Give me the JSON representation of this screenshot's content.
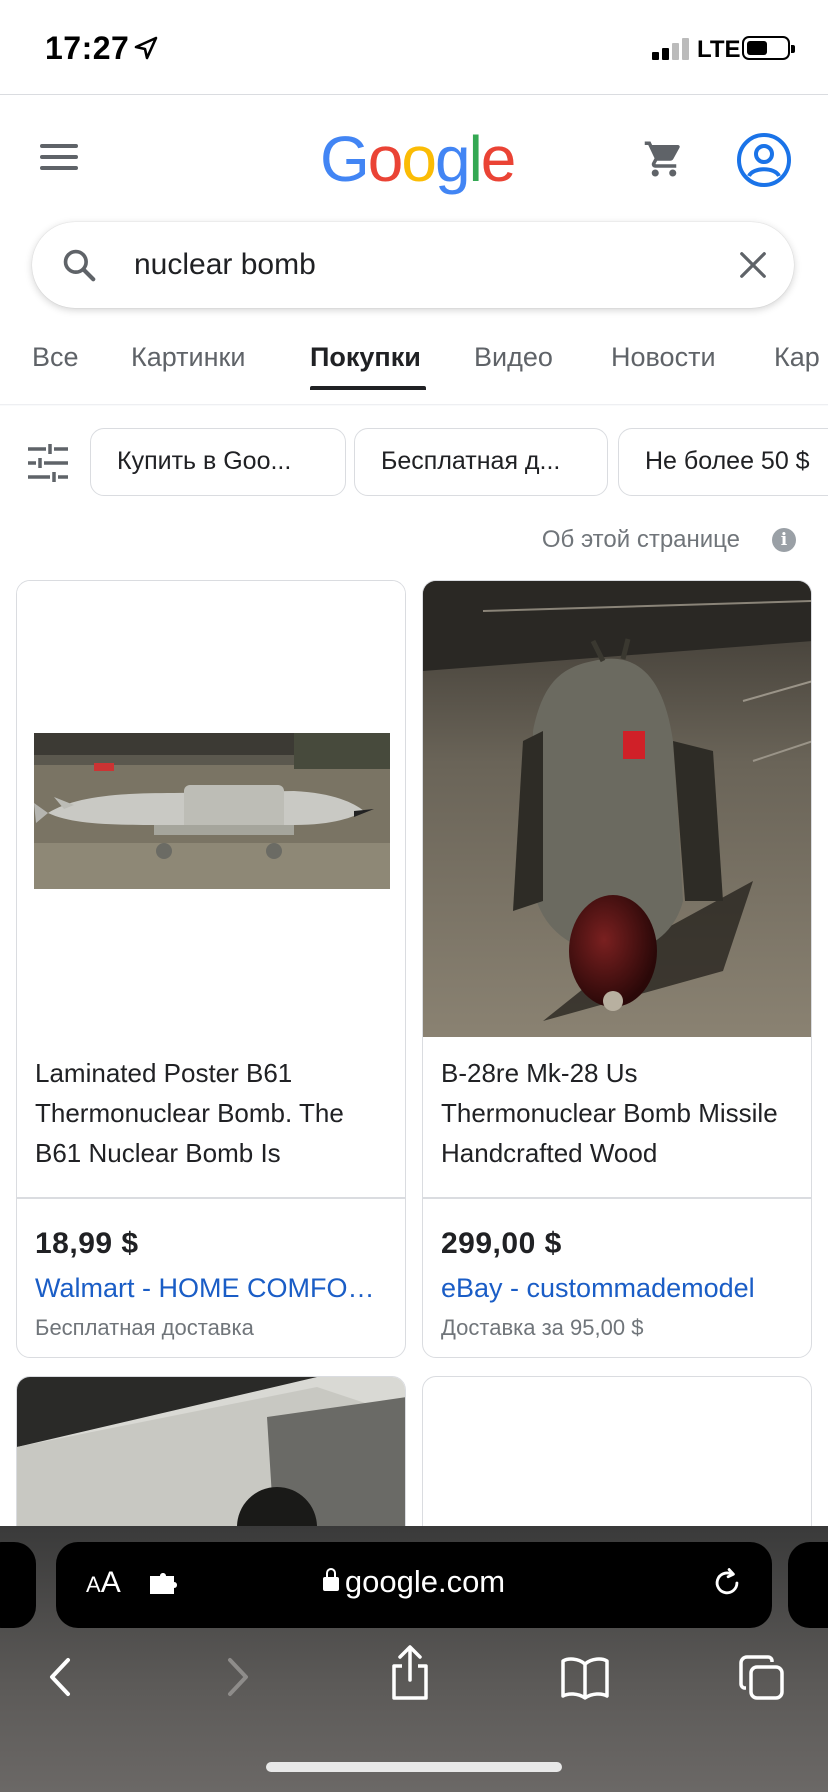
{
  "status_bar": {
    "time": "17:27",
    "network": "LTE"
  },
  "header": {
    "logo": "Google",
    "menu_icon": "menu-icon",
    "cart_icon": "cart-icon",
    "account_icon": "account-icon"
  },
  "search": {
    "query": "nuclear bomb",
    "icon": "search-icon",
    "clear_icon": "close-icon"
  },
  "tabs": [
    {
      "label": "Все",
      "active": false
    },
    {
      "label": "Картинки",
      "active": false
    },
    {
      "label": "Покупки",
      "active": true
    },
    {
      "label": "Видео",
      "active": false
    },
    {
      "label": "Новости",
      "active": false
    },
    {
      "label": "Кар",
      "active": false
    }
  ],
  "filters": {
    "icon": "tune-icon",
    "chips": [
      "Купить в Goo...",
      "Бесплатная д...",
      "Не более 50 $"
    ]
  },
  "about": {
    "text": "Об этой странице",
    "icon": "i"
  },
  "products": [
    {
      "title": "Laminated Poster B61 Thermonuclear Bomb. The B61 Nuclear Bomb Is",
      "price": "18,99 $",
      "seller": "Walmart - HOME COMFO…",
      "shipping": "Бесплатная доставка"
    },
    {
      "title": "B-28re Mk-28 Us Thermonuclear Bomb Missile Handcrafted Wood",
      "price": "299,00 $",
      "seller": "eBay - custommademodel",
      "shipping": "Доставка за 95,00 $"
    }
  ],
  "browser": {
    "text_size_label": "AA",
    "url": "google.com",
    "colors": {
      "link": "#1a5dc6",
      "google_blue": "#4285F4",
      "google_red": "#EA4335",
      "google_yellow": "#FBBC05",
      "google_green": "#34A853"
    }
  }
}
